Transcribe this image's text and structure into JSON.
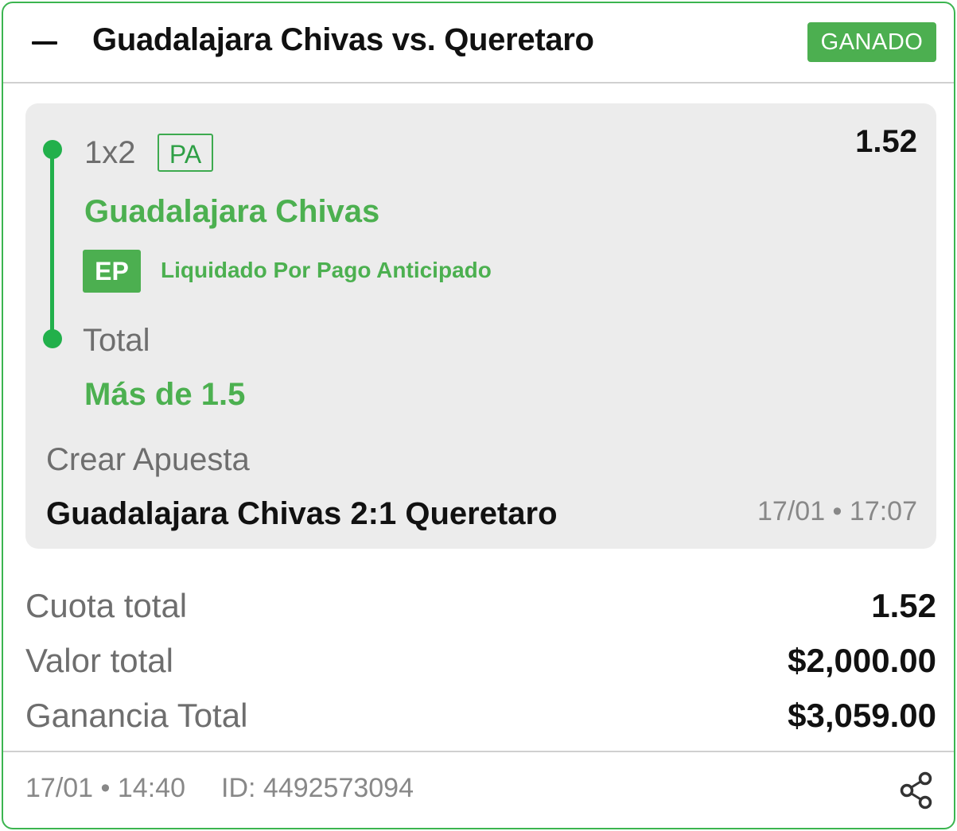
{
  "header": {
    "title": "Guadalajara Chivas vs. Queretaro",
    "status": "GANADO",
    "collapse_icon": "minus-icon"
  },
  "selections": [
    {
      "market": "1x2",
      "market_badge": "PA",
      "pick": "Guadalajara Chivas",
      "odds": "1.52",
      "settlement_badge": "EP",
      "settlement_text": "Liquidado Por Pago Anticipado"
    },
    {
      "market": "Total",
      "pick": "Más de 1.5"
    }
  ],
  "bet_builder": {
    "label": "Crear Apuesta",
    "score": "Guadalajara Chivas 2:1 Queretaro",
    "date": "17/01",
    "time": "17:07"
  },
  "summary": {
    "odds_label": "Cuota total",
    "odds_value": "1.52",
    "stake_label": "Valor total",
    "stake_value": "$2,000.00",
    "payout_label": "Ganancia Total",
    "payout_value": "$3,059.00"
  },
  "footer": {
    "date": "17/01",
    "time": "14:40",
    "id_label": "ID:",
    "id_value": "4492573094",
    "share_icon": "share-icon"
  },
  "colors": {
    "accent_green": "#4caf50",
    "timeline_green": "#22b04b",
    "card_border": "#3cb550",
    "panel_bg": "#ececec"
  }
}
